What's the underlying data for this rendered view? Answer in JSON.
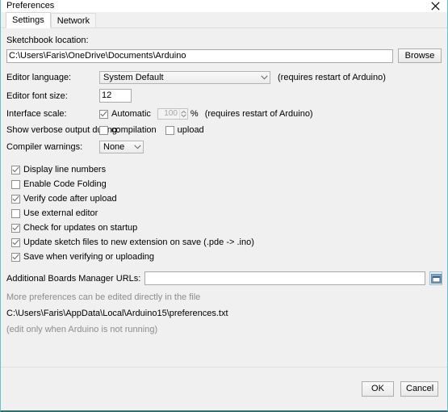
{
  "window": {
    "title": "Preferences",
    "close_icon": "close-icon"
  },
  "tabs": [
    {
      "label": "Settings",
      "active": true
    },
    {
      "label": "Network",
      "active": false
    }
  ],
  "settings": {
    "sketchbook": {
      "label": "Sketchbook location:",
      "value": "C:\\Users\\Faris\\OneDrive\\Documents\\Arduino",
      "browse_label": "Browse"
    },
    "editor_language": {
      "label": "Editor language:",
      "value": "System Default",
      "note": "(requires restart of Arduino)"
    },
    "editor_font_size": {
      "label": "Editor font size:",
      "value": "12"
    },
    "interface_scale": {
      "label": "Interface scale:",
      "automatic_label": "Automatic",
      "automatic_checked": true,
      "scale_value": "100",
      "percent": "%",
      "note": "(requires restart of Arduino)"
    },
    "verbose_output": {
      "label": "Show verbose output during:",
      "compilation_label": "compilation",
      "compilation_checked": false,
      "upload_label": "upload",
      "upload_checked": false
    },
    "compiler_warnings": {
      "label": "Compiler warnings:",
      "value": "None"
    },
    "checkboxes": [
      {
        "label": "Display line numbers",
        "checked": true
      },
      {
        "label": "Enable Code Folding",
        "checked": false
      },
      {
        "label": "Verify code after upload",
        "checked": true
      },
      {
        "label": "Use external editor",
        "checked": false
      },
      {
        "label": "Check for updates on startup",
        "checked": true
      },
      {
        "label": "Update sketch files to new extension on save (.pde -> .ino)",
        "checked": true
      },
      {
        "label": "Save when verifying or uploading",
        "checked": true
      }
    ],
    "boards_manager": {
      "label": "Additional Boards Manager URLs:",
      "value": "",
      "icon": "open-list-editor-icon"
    },
    "footer_notes": {
      "line1": "More preferences can be edited directly in the file",
      "path": "C:\\Users\\Faris\\AppData\\Local\\Arduino15\\preferences.txt",
      "line3": "(edit only when Arduino is not running)"
    }
  },
  "buttons": {
    "ok": "OK",
    "cancel": "Cancel"
  },
  "colors": {
    "window_border": "#6cbfc9",
    "panel_bg": "#f0f0f0",
    "field_bg": "#ffffff",
    "muted_text": "#8c8c8c"
  }
}
